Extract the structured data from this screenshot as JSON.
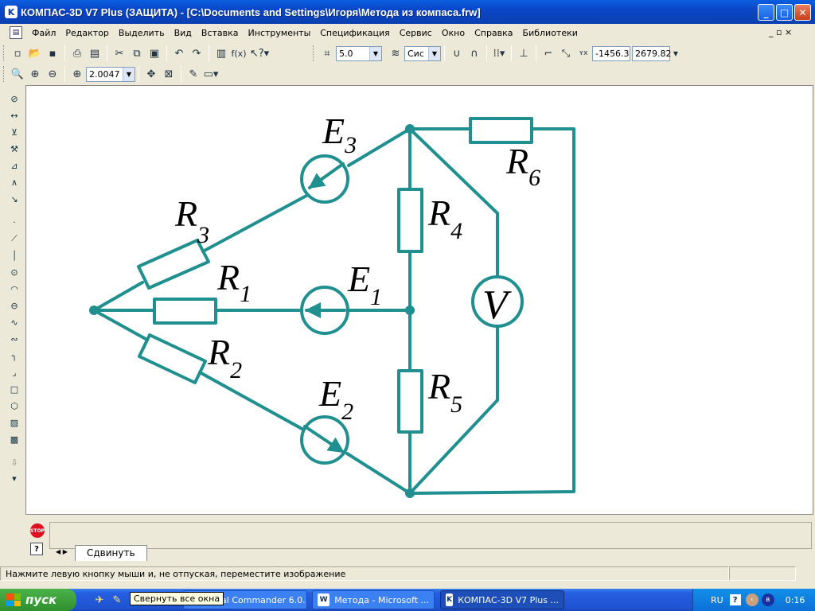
{
  "window": {
    "title": "КОМПАС-3D V7 Plus (ЗАЩИТА) - [C:\\Documents and Settings\\Игоря\\Метода из компаса.frw]",
    "minimize": "_",
    "maximize": "□",
    "close": "✕"
  },
  "menu": {
    "items": [
      "Файл",
      "Редактор",
      "Выделить",
      "Вид",
      "Вставка",
      "Инструменты",
      "Спецификация",
      "Сервис",
      "Окно",
      "Справка",
      "Библиотеки"
    ],
    "mdi_controls": "_ ▫ ×"
  },
  "toolbar1": {
    "step_value": "5.0",
    "layer_value": "Сис",
    "fx_label": "f(x)",
    "coord_x": "-1456.3",
    "coord_y": "2679.82"
  },
  "toolbar2": {
    "zoom_value": "2.0047"
  },
  "schematic": {
    "E3": {
      "letter": "E",
      "sub": "3"
    },
    "E1": {
      "letter": "E",
      "sub": "1"
    },
    "E2": {
      "letter": "E",
      "sub": "2"
    },
    "R1": {
      "letter": "R",
      "sub": "1"
    },
    "R2": {
      "letter": "R",
      "sub": "2"
    },
    "R3": {
      "letter": "R",
      "sub": "3"
    },
    "R4": {
      "letter": "R",
      "sub": "4"
    },
    "R5": {
      "letter": "R",
      "sub": "5"
    },
    "R6": {
      "letter": "R",
      "sub": "6"
    },
    "V": "V",
    "color": "#1f8f8f"
  },
  "command": {
    "stop_label": "STOP",
    "help_label": "?",
    "tab_label": "Сдвинуть"
  },
  "status": {
    "message": "Нажмите левую кнопку мыши и, не отпуская, переместите изображение"
  },
  "taskbar": {
    "start": "пуск",
    "tasks": [
      "otal Commander 6.0...",
      "Метода - Microsoft ...",
      "КОМПАС-3D V7 Plus ..."
    ],
    "tooltip": "Свернуть все окна",
    "lang": "RU",
    "clock": "0:16"
  }
}
